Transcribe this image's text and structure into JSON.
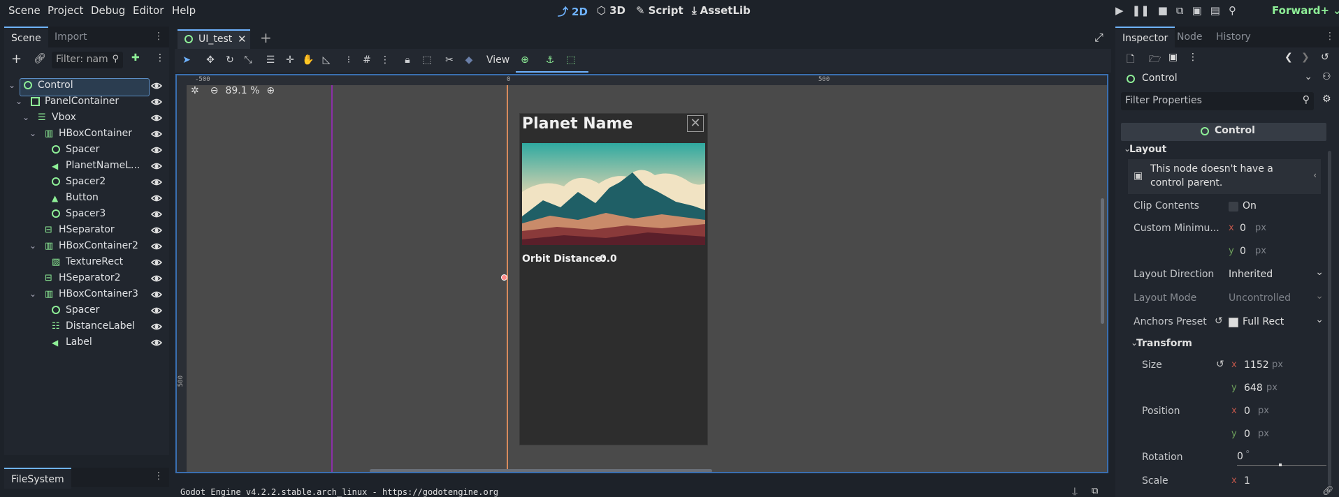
{
  "menu": [
    "Scene",
    "Project",
    "Debug",
    "Editor",
    "Help"
  ],
  "modes": {
    "mode_2d": "2D",
    "mode_3d": "3D",
    "script": "Script",
    "assetlib": "AssetLib"
  },
  "renderer": "Forward+",
  "left_dock": {
    "tabs": [
      "Scene",
      "Import"
    ],
    "filter_placeholder": "Filter: nam",
    "tree": [
      {
        "label": "Control",
        "icon": "control-node-icon",
        "depth": 0,
        "selected": true
      },
      {
        "label": "PanelContainer",
        "icon": "panel-container-icon",
        "depth": 1
      },
      {
        "label": "Vbox",
        "icon": "vbox-icon",
        "depth": 2
      },
      {
        "label": "HBoxContainer",
        "icon": "hbox-icon",
        "depth": 3
      },
      {
        "label": "Spacer",
        "icon": "control-node-icon",
        "depth": 4
      },
      {
        "label": "PlanetNameL...",
        "icon": "label-icon",
        "depth": 4
      },
      {
        "label": "Spacer2",
        "icon": "control-node-icon",
        "depth": 4
      },
      {
        "label": "Button",
        "icon": "button-icon",
        "depth": 4
      },
      {
        "label": "Spacer3",
        "icon": "control-node-icon",
        "depth": 4
      },
      {
        "label": "HSeparator",
        "icon": "hseparator-icon",
        "depth": 3
      },
      {
        "label": "HBoxContainer2",
        "icon": "hbox-icon",
        "depth": 3
      },
      {
        "label": "TextureRect",
        "icon": "texture-rect-icon",
        "depth": 4
      },
      {
        "label": "HSeparator2",
        "icon": "hseparator-icon",
        "depth": 3
      },
      {
        "label": "HBoxContainer3",
        "icon": "hbox-icon",
        "depth": 3
      },
      {
        "label": "Spacer",
        "icon": "control-node-icon",
        "depth": 4
      },
      {
        "label": "DistanceLabel",
        "icon": "rich-label-icon",
        "depth": 4
      },
      {
        "label": "Label",
        "icon": "label-icon",
        "depth": 4
      }
    ],
    "filesystem_tab": "FileSystem"
  },
  "scene_tab": {
    "name": "UI_test"
  },
  "toolbar": {
    "view_label": "View"
  },
  "viewport": {
    "zoom": "89.1 %",
    "ruler": {
      "neg500": "-500",
      "zero": "0",
      "pos500": "500",
      "left500": "500"
    },
    "panel": {
      "title": "Planet Name",
      "orbit_label": "Orbit Distance:",
      "orbit_value": "0.0"
    }
  },
  "inspector": {
    "tabs": [
      "Inspector",
      "Node",
      "History"
    ],
    "node_type": "Control",
    "filter_placeholder": "Filter Properties",
    "class_header": "Control",
    "layout_section": "Layout",
    "warning": "This node doesn't have a control parent.",
    "clip_contents": {
      "label": "Clip Contents",
      "value": "On"
    },
    "custom_min": {
      "label": "Custom Minimu...",
      "x": "0",
      "y": "0",
      "unit": "px"
    },
    "layout_direction": {
      "label": "Layout Direction",
      "value": "Inherited"
    },
    "layout_mode": {
      "label": "Layout Mode",
      "value": "Uncontrolled"
    },
    "anchors_preset": {
      "label": "Anchors Preset",
      "value": "Full Rect"
    },
    "transform_section": "Transform",
    "size": {
      "label": "Size",
      "x": "1152",
      "y": "648",
      "unit": "px"
    },
    "position": {
      "label": "Position",
      "x": "0",
      "y": "0",
      "unit": "px"
    },
    "rotation": {
      "label": "Rotation",
      "value": "0",
      "unit": "°"
    },
    "scale": {
      "label": "Scale",
      "x": "1"
    }
  },
  "output": {
    "text": "Godot Engine v4.2.2.stable.arch_linux - https://godotengine.org"
  },
  "colors": {
    "accent": "#6fb3ff",
    "node_green": "#8eef97",
    "panel_bg": "#2d2d2d",
    "viewport_bg": "#4a4a4a"
  }
}
